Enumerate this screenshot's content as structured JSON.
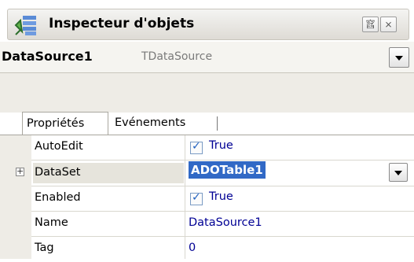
{
  "window": {
    "title": "Inspecteur d'objets",
    "pin_label": "窞",
    "close_label": "⨯"
  },
  "selector": {
    "object_name": "DataSource1",
    "object_type": "TDataSource"
  },
  "tabs": [
    {
      "label": "Propriétés",
      "active": true
    },
    {
      "label": "Evénements",
      "active": false
    }
  ],
  "properties": [
    {
      "name": "AutoEdit",
      "value": "True",
      "checkbox": true
    },
    {
      "name": "DataSet",
      "value": "ADOTable1",
      "expandable": true,
      "selected": true
    },
    {
      "name": "Enabled",
      "value": "True",
      "checkbox": true
    },
    {
      "name": "Name",
      "value": "DataSource1"
    },
    {
      "name": "Tag",
      "value": "0"
    }
  ],
  "colors": {
    "value_text": "#000094",
    "selection": "#3169c6",
    "panel_bg": "#eeece6"
  },
  "icons": {
    "title": "inspector-icon",
    "expander": "plus-box-icon"
  }
}
